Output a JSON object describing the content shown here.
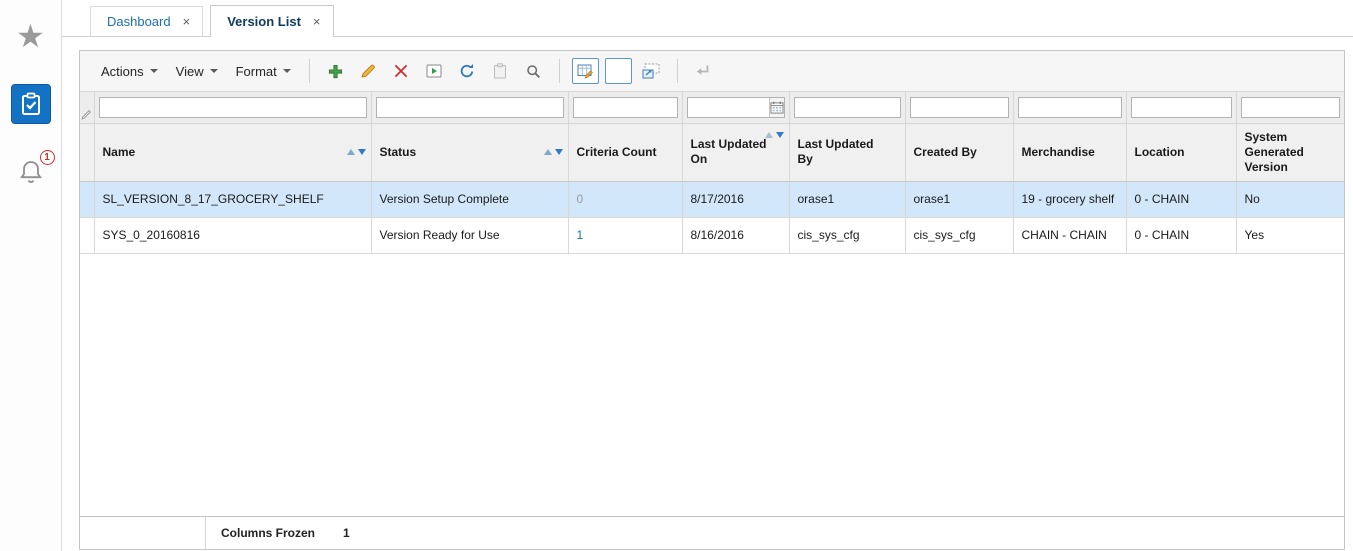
{
  "colors": {
    "accent_blue": "#1b6fb5",
    "active_tab_text": "#0d3a5e",
    "selected_row": "#d2e7f9",
    "active_tile": "#1472c4",
    "badge_red": "#c9302c"
  },
  "sidebar": {
    "items": [
      {
        "id": "favorites",
        "icon": "star-icon",
        "active": false,
        "badge": ""
      },
      {
        "id": "tasks",
        "icon": "clipboard-check-icon",
        "active": true,
        "badge": ""
      },
      {
        "id": "notifications",
        "icon": "bell-icon",
        "active": false,
        "badge": "1"
      }
    ]
  },
  "tabs": {
    "items": [
      {
        "label": "Dashboard",
        "close": "×",
        "active": false
      },
      {
        "label": "Version List",
        "close": "×",
        "active": true
      }
    ]
  },
  "toolbar": {
    "menus": [
      {
        "label": "Actions"
      },
      {
        "label": "View"
      },
      {
        "label": "Format"
      }
    ],
    "buttons": [
      {
        "icon": "plus-icon",
        "enabled": true,
        "pressed": false
      },
      {
        "icon": "pencil-icon",
        "enabled": true,
        "pressed": false
      },
      {
        "icon": "delete-x-icon",
        "enabled": true,
        "pressed": false
      },
      {
        "icon": "play-icon",
        "enabled": true,
        "pressed": false
      },
      {
        "icon": "refresh-icon",
        "enabled": true,
        "pressed": false
      },
      {
        "icon": "clipboard-icon",
        "enabled": false,
        "pressed": false
      },
      {
        "icon": "magnifier-icon",
        "enabled": true,
        "pressed": false
      },
      {
        "icon": "table-filter-icon",
        "enabled": true,
        "pressed": true
      },
      {
        "icon": "blank-box-icon",
        "enabled": true,
        "pressed": true
      },
      {
        "icon": "detach-icon",
        "enabled": true,
        "pressed": false
      },
      {
        "icon": "return-arrow-icon",
        "enabled": false,
        "pressed": false
      }
    ]
  },
  "filter_row": {
    "values": [
      "",
      "",
      "",
      "",
      "",
      "",
      "",
      "",
      ""
    ],
    "date_picker_icon": "calendar-icon"
  },
  "table": {
    "columns": [
      {
        "id": "name",
        "label": "Name",
        "sort": "both"
      },
      {
        "id": "status",
        "label": "Status",
        "sort": "both"
      },
      {
        "id": "criteria_count",
        "label": "Criteria Count",
        "sort": "none"
      },
      {
        "id": "last_updated_on",
        "label": "Last Updated On",
        "sort": "desc"
      },
      {
        "id": "last_updated_by",
        "label": "Last Updated By",
        "sort": "none"
      },
      {
        "id": "created_by",
        "label": "Created By",
        "sort": "none"
      },
      {
        "id": "merchandise",
        "label": "Merchandise",
        "sort": "none"
      },
      {
        "id": "location",
        "label": "Location",
        "sort": "none"
      },
      {
        "id": "system_generated_version",
        "label": "System Generated Version",
        "sort": "none"
      }
    ],
    "rows": [
      {
        "selected": true,
        "cells": [
          "SL_VERSION_8_17_GROCERY_SHELF",
          "Version Setup Complete",
          "0",
          "8/17/2016",
          "orase1",
          "orase1",
          "19 - grocery shelf",
          "0 - CHAIN",
          "No"
        ]
      },
      {
        "selected": false,
        "cells": [
          "SYS_0_20160816",
          "Version Ready for Use",
          "1",
          "8/16/2016",
          "cis_sys_cfg",
          "cis_sys_cfg",
          "CHAIN - CHAIN",
          "0 - CHAIN",
          "Yes"
        ]
      }
    ]
  },
  "footer": {
    "columns_frozen_label": "Columns Frozen",
    "columns_frozen_value": "1"
  }
}
